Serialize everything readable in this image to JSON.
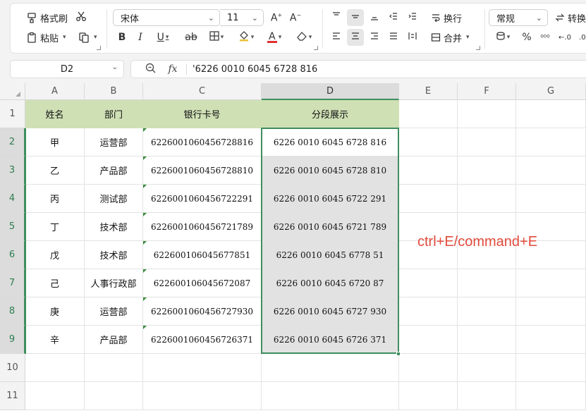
{
  "ribbon": {
    "format_painter": "格式刷",
    "paste": "粘贴",
    "font_name": "宋体",
    "font_size": "11",
    "wrap_text": "换行",
    "merge": "合并",
    "number_format": "常规",
    "convert": "转换"
  },
  "formula_bar": {
    "name_box": "D2",
    "fx_label": "fx",
    "content": "'6226 0010 6045 6728 816"
  },
  "columns": [
    "A",
    "B",
    "C",
    "D",
    "E",
    "F",
    "G"
  ],
  "rows": [
    "1",
    "2",
    "3",
    "4",
    "5",
    "6",
    "7",
    "8",
    "9",
    "10",
    "11"
  ],
  "headers": {
    "name": "姓名",
    "dept": "部门",
    "card": "银行卡号",
    "split": "分段展示"
  },
  "records": [
    {
      "name": "甲",
      "dept": "运营部",
      "card": "6226001060456728816",
      "split": "6226 0010 6045 6728 816"
    },
    {
      "name": "乙",
      "dept": "产品部",
      "card": "6226001060456728810",
      "split": "6226 0010 6045 6728 810"
    },
    {
      "name": "丙",
      "dept": "测试部",
      "card": "6226001060456722291",
      "split": "6226 0010 6045 6722 291"
    },
    {
      "name": "丁",
      "dept": "技术部",
      "card": "6226001060456721789",
      "split": "6226 0010 6045 6721 789"
    },
    {
      "name": "戊",
      "dept": "技术部",
      "card": "622600106045677851",
      "split": "6226 0010 6045 6778 51"
    },
    {
      "name": "己",
      "dept": "人事行政部",
      "card": "622600106045672087",
      "split": "6226 0010 6045 6720 87"
    },
    {
      "name": "庚",
      "dept": "运营部",
      "card": "6226001060456727930",
      "split": "6226 0010 6045 6727 930"
    },
    {
      "name": "辛",
      "dept": "产品部",
      "card": "6226001060456726371",
      "split": "6226 0010 6045 6726 371"
    }
  ],
  "annotation": "ctrl+E/command+E",
  "colors": {
    "header_fill": "#cfe0b5",
    "selection": "#3e8e5e",
    "annotation": "#e24a3b"
  }
}
